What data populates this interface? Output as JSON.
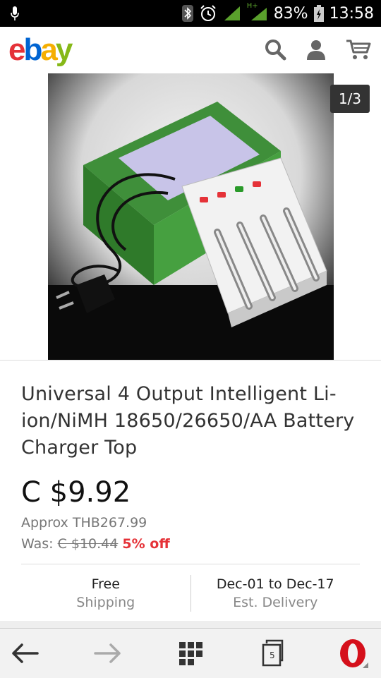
{
  "status_bar": {
    "network": "H+",
    "battery": "83%",
    "time": "13:58"
  },
  "header": {
    "logo_letters": [
      "e",
      "b",
      "a",
      "y"
    ],
    "icons": [
      "search-icon",
      "account-icon",
      "cart-icon"
    ]
  },
  "gallery": {
    "counter": "1/3"
  },
  "item": {
    "title": "Universal 4 Output Intelligent Li-ion/NiMH 18650/26650/AA Battery Charger Top",
    "price": "C $9.92",
    "approx": "Approx THB267.99",
    "was_label": "Was:",
    "was_price": "C $10.44",
    "discount": "5% off"
  },
  "shipping": {
    "main": "Free",
    "sub": "Shipping"
  },
  "delivery": {
    "main": "Dec-01 to Dec-17",
    "sub": "Est. Delivery"
  },
  "browser_bar": {
    "tabs_count": "5",
    "icons": [
      "back-arrow-icon",
      "forward-arrow-icon",
      "speed-dial-icon",
      "tabs-icon",
      "opera-menu-icon"
    ]
  },
  "colors": {
    "ebay_red": "#e53238",
    "ebay_blue": "#0064d2",
    "ebay_yellow": "#f5af02",
    "ebay_green": "#86b817",
    "discount_red": "#e53238"
  }
}
